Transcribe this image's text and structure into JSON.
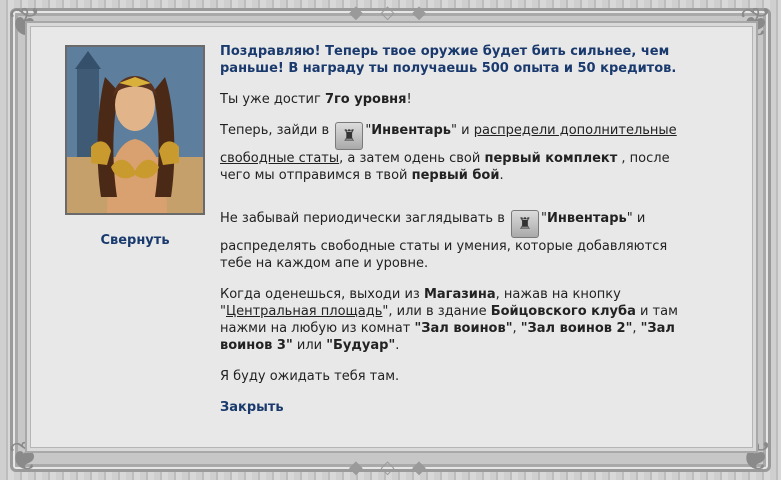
{
  "dialog": {
    "collapse_label": "Свернуть",
    "close_label": "Закрыть",
    "headline": "Поздравляю! Теперь твое оружие будет бить сильнее, чем раньше! В награду ты получаешь 500 опыта и 50 кредитов.",
    "level": {
      "pre": "Ты уже достиг ",
      "bold": "7го уровня",
      "post": "!"
    },
    "p2": {
      "t1": "Теперь, зайди в ",
      "q1": "\"",
      "inventory": "Инвентарь",
      "q2": "\"",
      "t2": " и ",
      "link": "распредели дополнительные свободные статы",
      "t3": ", а затем одень свой ",
      "bold1": "первый комплект",
      "t4": " , после чего мы отправимся в твой ",
      "bold2": "первый бой",
      "t5": "."
    },
    "p3": {
      "t1": "Не забывай периодически заглядывать в ",
      "q1": "\"",
      "inventory": "Инвентарь",
      "q2": "\"",
      "t2": " и распределять свободные статы и умения, которые добавляются тебе на каждом апе и уровне."
    },
    "p4": {
      "t1": "Когда оденешься, выходи из ",
      "shop": "Магазина",
      "t2": ", нажав на кнопку \"",
      "link": "Центральная площадь",
      "t3": "\", или в здание ",
      "club": "Бойцовского клуба",
      "t4": " и там нажми на любую из комнат ",
      "r1": "\"Зал воинов\"",
      "s1": ", ",
      "r2": "\"Зал воинов 2\"",
      "s2": ", ",
      "r3": "\"Зал воинов 3\"",
      "s3": " или ",
      "r4": "\"Будуар\"",
      "t5": "."
    },
    "p5": "Я буду ожидать тебя там.",
    "inventory_icon": "bag-icon"
  }
}
